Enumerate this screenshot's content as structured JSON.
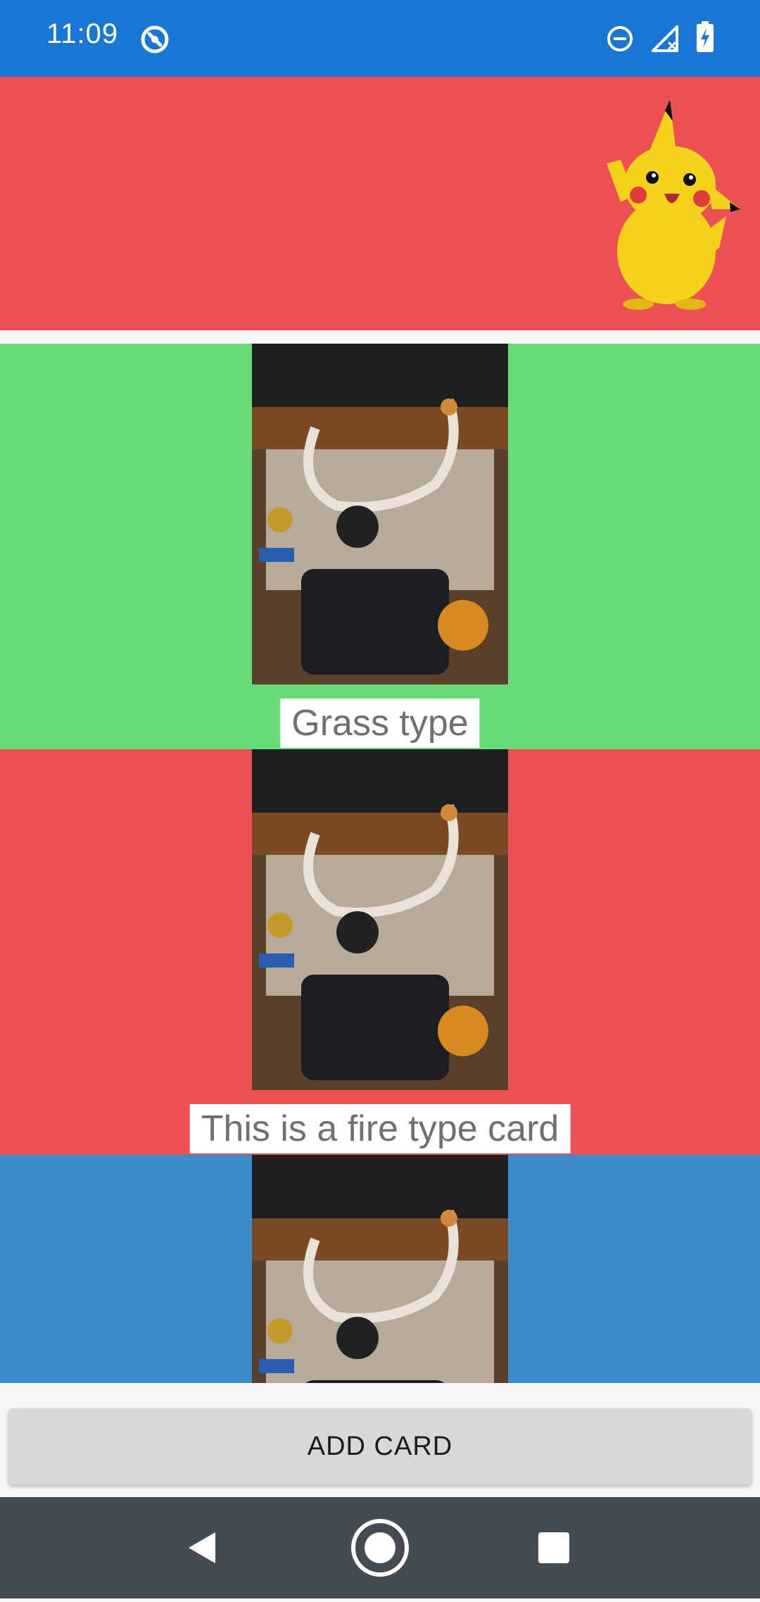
{
  "status_bar": {
    "time": "11:09",
    "icons": [
      "alert-circle-icon",
      "do-not-disturb-icon",
      "no-signal-icon",
      "battery-charging-icon"
    ],
    "color": "#1976d2"
  },
  "header": {
    "color": "#eb5055",
    "mascot": "pikachu-image"
  },
  "cards": [
    {
      "color": "#66dd7a",
      "caption": "Grass type"
    },
    {
      "color": "#eb5055",
      "caption": "This is a fire type card"
    },
    {
      "color": "#3a8ccc",
      "caption": ""
    }
  ],
  "actions": {
    "add_card_label": "ADD CARD"
  },
  "nav_bar": {
    "buttons": [
      "back-icon",
      "home-icon",
      "recents-icon"
    ],
    "color": "#444b52"
  }
}
